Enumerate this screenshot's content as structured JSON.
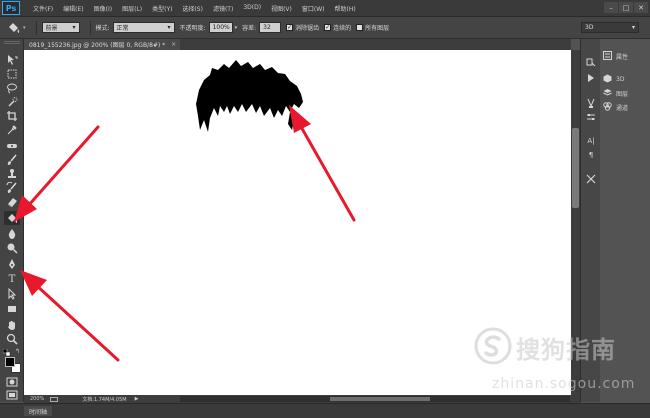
{
  "app": {
    "logo": "Ps"
  },
  "menu": [
    "文件(F)",
    "编辑(E)",
    "图像(I)",
    "图层(L)",
    "类型(Y)",
    "选择(S)",
    "滤镜(T)",
    "3D(D)",
    "视图(V)",
    "窗口(W)",
    "帮助(H)"
  ],
  "window_controls": {
    "minimize": "–",
    "restore": "□",
    "close": "✕"
  },
  "options": {
    "fill_source": "前景",
    "mode_label": "模式:",
    "mode_value": "正常",
    "opacity_label": "不透明度:",
    "opacity_value": "100%",
    "tolerance_label": "容差:",
    "tolerance_value": "32",
    "antialias_label": "消除锯齿",
    "antialias_checked": true,
    "contiguous_label": "连续的",
    "contiguous_checked": true,
    "all_layers_label": "所有图层",
    "all_layers_checked": false,
    "workspace": "3D"
  },
  "document_tab": {
    "title": "0819_155236.jpg @ 200% (图层 0, RGB/8#) *",
    "close": "×"
  },
  "status": {
    "zoom": "200%",
    "doc_info": "文档:1.74M/4.05M"
  },
  "timeline": {
    "label": "时间轴"
  },
  "panels": [
    {
      "label": "属性",
      "icon": "properties-icon"
    },
    {
      "label": "3D",
      "icon": "3d-icon"
    },
    {
      "label": "图层",
      "icon": "layers-icon"
    },
    {
      "label": "通道",
      "icon": "channels-icon"
    }
  ],
  "tools": [
    "move-tool-icon",
    "marquee-tool-icon",
    "lasso-tool-icon",
    "quick-select-tool-icon",
    "crop-tool-icon",
    "eyedropper-tool-icon",
    "healing-brush-tool-icon",
    "brush-tool-icon",
    "clone-stamp-tool-icon",
    "history-brush-tool-icon",
    "eraser-tool-icon",
    "paint-bucket-tool-icon",
    "blur-tool-icon",
    "dodge-tool-icon",
    "pen-tool-icon",
    "type-tool-icon",
    "path-select-tool-icon",
    "rectangle-tool-icon",
    "hand-tool-icon",
    "zoom-tool-icon"
  ],
  "colors": {
    "annotation_arrow": "#e8192c",
    "foreground": "#000000",
    "background": "#ffffff",
    "accent": "#31a8ff"
  },
  "watermark": {
    "text": "搜狗指南",
    "url": "zhinan.sogou.com"
  }
}
